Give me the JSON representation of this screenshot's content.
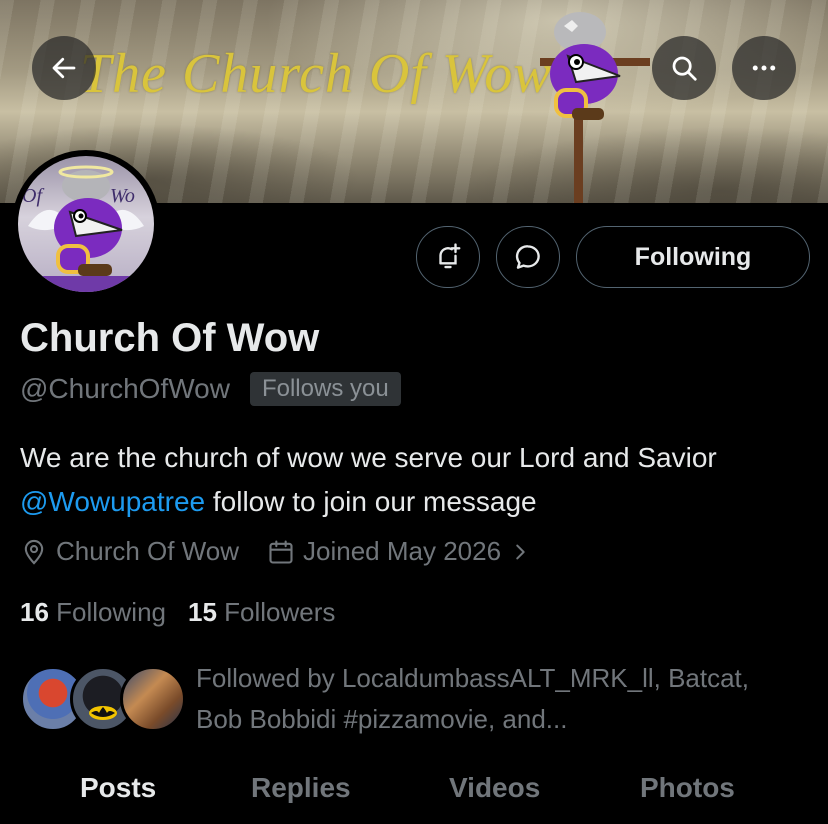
{
  "banner": {
    "title": "The Church Of Wow"
  },
  "header_buttons": {
    "back_icon": "arrow-left-icon",
    "search_icon": "search-icon",
    "more_icon": "more-horizontal-icon"
  },
  "actions": {
    "notify_icon": "bell-plus-icon",
    "message_icon": "chat-bubble-icon",
    "follow_label": "Following"
  },
  "profile": {
    "name": "Church Of Wow",
    "handle": "@ChurchOfWow",
    "follows_you": "Follows you",
    "bio_before": "We are the church of wow we serve our Lord and Savior ",
    "bio_mention": "@Wowupatree",
    "bio_after": " follow to join our message",
    "location": "Church Of Wow",
    "joined": "Joined May 2026"
  },
  "stats": {
    "following_count": "16",
    "following_label": "Following",
    "followers_count": "15",
    "followers_label": "Followers"
  },
  "followed_by": {
    "text": "Followed by LocaldumbassALT_MRK_ll, Batcat, Bob Bobbidi #pizzamovie, and..."
  },
  "tabs": [
    {
      "label": "Posts",
      "active": true
    },
    {
      "label": "Replies",
      "active": false
    },
    {
      "label": "Videos",
      "active": false
    },
    {
      "label": "Photos",
      "active": false
    }
  ],
  "colors": {
    "background": "#000000",
    "text": "#e7e9ea",
    "muted": "#71767b",
    "link": "#1d9bf0",
    "banner_title": "#d9c43c",
    "mascot_purple": "#7b2bbf"
  }
}
